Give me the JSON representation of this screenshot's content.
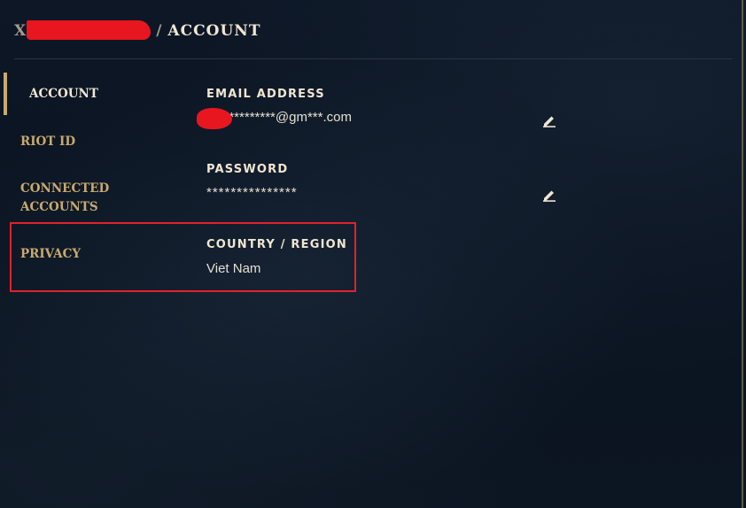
{
  "header": {
    "root_label": "X",
    "separator": "/",
    "current_label": "ACCOUNT"
  },
  "sidebar": {
    "items": [
      {
        "label": "ACCOUNT",
        "active": true
      },
      {
        "label": "RIOT ID"
      },
      {
        "label": "CONNECTED"
      },
      {
        "label": "ACCOUNTS"
      },
      {
        "label": "PRIVACY"
      }
    ]
  },
  "fields": {
    "email": {
      "label": "EMAIL ADDRESS",
      "value": "o*********@gm***.com",
      "edit_icon": "pencil-icon"
    },
    "password": {
      "label": "PASSWORD",
      "value": "***************",
      "edit_icon": "pencil-icon"
    },
    "country": {
      "label": "COUNTRY / REGION",
      "value": "Viet Nam"
    }
  },
  "colors": {
    "accent_gold": "#c8aa6e",
    "text_light": "#f0e6d2",
    "background": "#0b1422",
    "annotation_red": "#e1222b",
    "redaction_red": "#e8161e"
  }
}
